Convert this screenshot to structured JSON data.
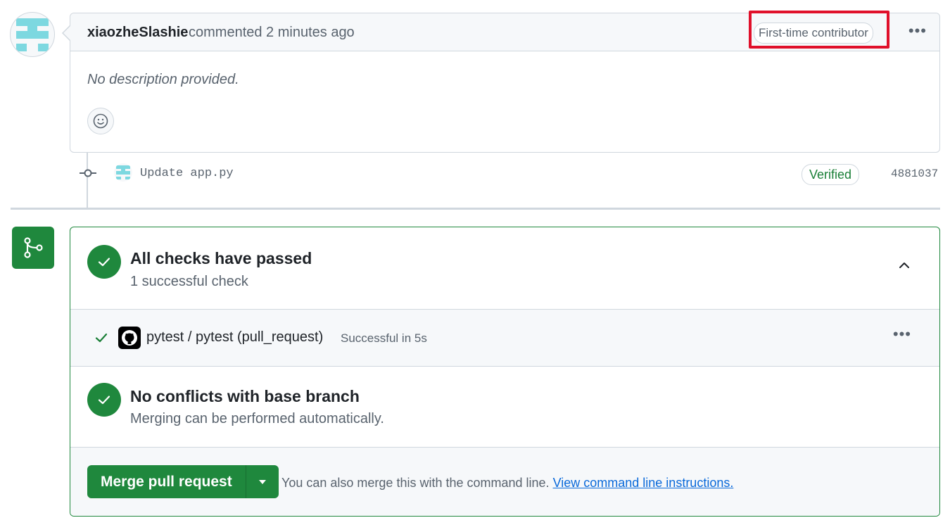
{
  "comment": {
    "author": "xiaozheSlashie",
    "action": "commented 2 minutes ago",
    "badge": "First-time contributor",
    "more": "•••",
    "description": "No description provided."
  },
  "commit": {
    "message": "Update app.py",
    "verified": "Verified",
    "sha": "4881037"
  },
  "checks": {
    "title": "All checks have passed",
    "subtitle": "1 successful check",
    "items": [
      {
        "name": "pytest / pytest (pull_request)",
        "status": "Successful in 5s",
        "more": "•••"
      }
    ]
  },
  "conflicts": {
    "title": "No conflicts with base branch",
    "subtitle": "Merging can be performed automatically."
  },
  "merge": {
    "button_label": "Merge pull request",
    "note": "You can also merge this with the command line.",
    "link": "View command line instructions."
  },
  "colors": {
    "success": "#1f883d",
    "highlight": "#e0102a",
    "link": "#0969da",
    "avatar": "#7dd8e0"
  }
}
